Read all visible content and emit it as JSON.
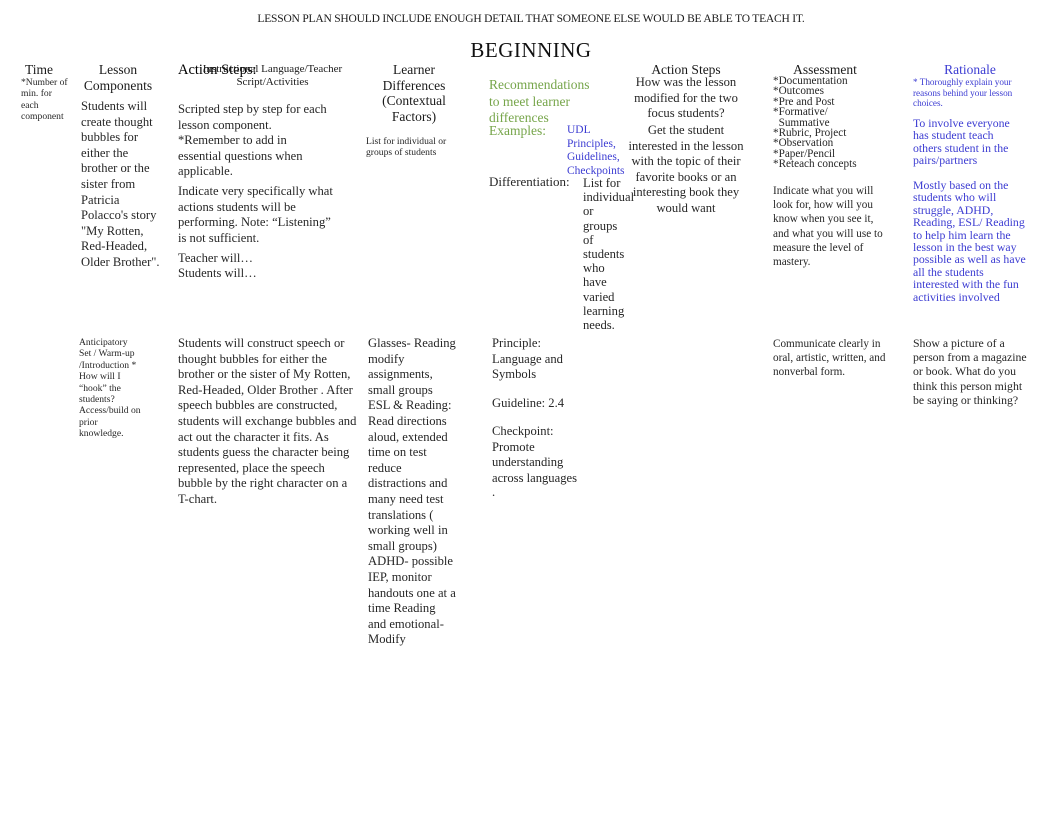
{
  "document": {
    "banner": "LESSON PLAN SHOULD INCLUDE ENOUGH DETAIL THAT SOMEONE ELSE WOULD BE ABLE TO TEACH IT.",
    "title": "BEGINNING"
  },
  "colors": {
    "green": "#76a54a",
    "blue": "#3c3cd2",
    "text": "#262626"
  },
  "columns": {
    "time": {
      "header": "Time",
      "note": "*Number of min. for each component"
    },
    "lesson_components": {
      "header": "Lesson Components",
      "body": "Students will create thought bubbles for either the brother or the sister from Patricia Polacco's story \"My Rotten, Red-Headed, Older Brother\"."
    },
    "action_steps_1": {
      "header": "Action Steps:",
      "header_note": "Instructional Language/Teacher Script/Activities",
      "para1": "Scripted step by step for each lesson component. *Remember to add in essential questions when applicable.",
      "para2": "Indicate very specifically what actions students will be performing. Note: “Listening” is not sufficient.",
      "para3_line1": "Teacher will…",
      "para3_line2": "Students will…"
    },
    "learner_differences": {
      "header": "Learner Differences (Contextual Factors)",
      "body": "List for individual or groups of students"
    },
    "recommendations": {
      "header_green": "Recommendations to meet learner differences",
      "examples_label": "Examples:",
      "examples_link": "UDL Principles, Guidelines, Checkpoints",
      "differentiation_label": "Differentiation:",
      "differentiation_body": "List for individual or groups of students who have varied learning needs."
    },
    "action_steps_2": {
      "header": "Action Steps",
      "header_note": "How was the lesson modified for the two focus students?",
      "body": "Get the student interested in the lesson with the topic of their favorite books or an interesting book they would want"
    },
    "assessment": {
      "header": "Assessment",
      "bullets": [
        "*Documentation",
        "*Outcomes",
        "*Pre and Post",
        "*Formative/",
        "  Summative",
        "*Rubric, Project",
        "*Observation",
        "*Paper/Pencil",
        "*Reteach concepts"
      ],
      "note": "Indicate what you will look for, how will you know when you see it, and what you will use to measure the level of mastery."
    },
    "rationale": {
      "header": "Rationale",
      "note": "* Thoroughly explain your reasons behind your        lesson choices.",
      "para1": "To involve everyone has student teach others student in the pairs/partners",
      "para2": "Mostly based on the students who will struggle, ADHD, Reading, ESL/ Reading to help him learn the lesson in the best way possible as well as have all the students interested         with the fun activities involved"
    }
  },
  "row_anticipatory": {
    "time_cell": "Anticipatory Set / Warm-up /Introduction * How will I “hook” the students? Access/build on prior knowledge.",
    "lesson_components_cell": "Students will construct speech or thought bubbles for either the brother or the sister of    My Rotten, Red-Headed, Older Brother    . After speech bubbles are constructed, students will exchange bubbles and act out the character it fits. As students guess the character being represented, place the speech bubble by the right character on a T-chart.",
    "learner_differences_cell": "Glasses- Reading modify assignments, small groups ESL & Reading: Read directions aloud, extended time on test reduce distractions and many need test translations ( working well in small   groups) ADHD- possible IEP, monitor handouts one at a time Reading and emotional- Modify",
    "recommendations_cell": {
      "principle": "Principle: Language and Symbols",
      "guideline": "Guideline: 2.4",
      "checkpoint": "Checkpoint: Promote understanding across languages",
      "trailing": "."
    },
    "assessment_cell": "Communicate clearly in oral, artistic, written, and nonverbal form.",
    "rationale_cell": "Show a picture of a person from a magazine or book. What do you think this person might be saying or thinking?"
  }
}
